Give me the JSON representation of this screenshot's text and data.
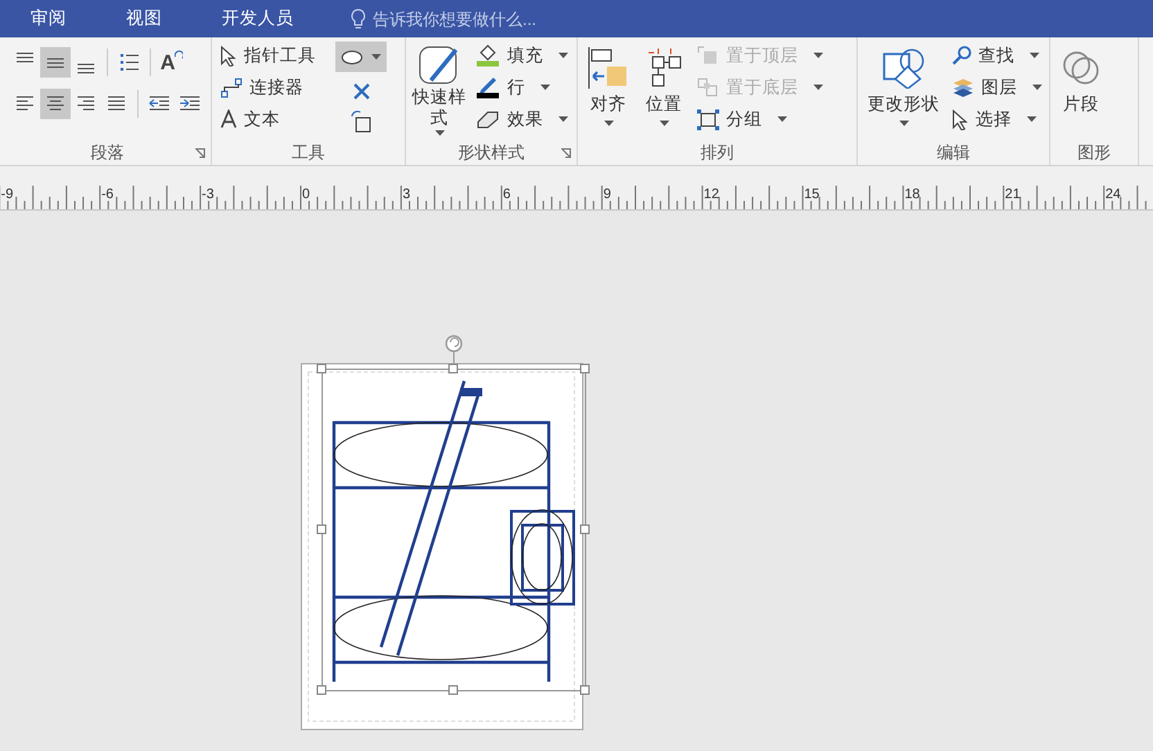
{
  "tabs": [
    {
      "label": "审阅",
      "selected": false
    },
    {
      "label": "视图",
      "selected": false
    },
    {
      "label": "开发人员",
      "selected": false
    }
  ],
  "tell_me": {
    "placeholder": "告诉我你想要做什么..."
  },
  "paragraph": {
    "label": "段落",
    "rows": [
      [
        {
          "kind": "align-top",
          "selected": false
        },
        {
          "kind": "align-middle",
          "selected": true
        },
        {
          "kind": "align-bottom",
          "selected": false
        },
        {
          "kind": "sep"
        },
        {
          "kind": "bullets",
          "selected": false
        },
        {
          "kind": "sep"
        },
        {
          "kind": "text-direction",
          "selected": false,
          "glyph": "A"
        }
      ],
      [
        {
          "kind": "align-left",
          "selected": false
        },
        {
          "kind": "align-center",
          "selected": true
        },
        {
          "kind": "align-right",
          "selected": false
        },
        {
          "kind": "justify",
          "selected": false
        },
        {
          "kind": "sep"
        },
        {
          "kind": "outdent",
          "selected": false
        },
        {
          "kind": "indent",
          "selected": false
        }
      ]
    ]
  },
  "tools": {
    "label": "工具",
    "items": [
      {
        "label": "指针工具",
        "kind": "pointer"
      },
      {
        "label": "连接器",
        "kind": "connector"
      },
      {
        "label": "文本",
        "kind": "text"
      }
    ],
    "shape_picker": {
      "selected": true
    }
  },
  "shape_styles": {
    "label": "形状样式",
    "quick_styles": {
      "label": "快速样式"
    },
    "items": [
      {
        "label": "填充",
        "kind": "fill"
      },
      {
        "label": "行",
        "kind": "line"
      },
      {
        "label": "效果",
        "kind": "effect"
      }
    ]
  },
  "arrange": {
    "label": "排列",
    "large": [
      {
        "label": "对齐",
        "kind": "align"
      },
      {
        "label": "位置",
        "kind": "position"
      }
    ],
    "small": [
      {
        "label": "置于顶层",
        "kind": "front",
        "disabled": true
      },
      {
        "label": "置于底层",
        "kind": "back",
        "disabled": true
      },
      {
        "label": "分组",
        "kind": "group",
        "disabled": false
      }
    ]
  },
  "editing": {
    "label": "编辑",
    "large": {
      "label": "更改形状"
    },
    "small": [
      {
        "label": "查找",
        "kind": "find"
      },
      {
        "label": "图层",
        "kind": "layers"
      },
      {
        "label": "选择",
        "kind": "select"
      }
    ]
  },
  "shapes": {
    "label": "图形",
    "large": {
      "label": "片段"
    }
  },
  "ruler": [
    "-9",
    "-6",
    "-3",
    "0",
    "3",
    "6",
    "9",
    "12",
    "15",
    "18",
    "21",
    "24"
  ]
}
